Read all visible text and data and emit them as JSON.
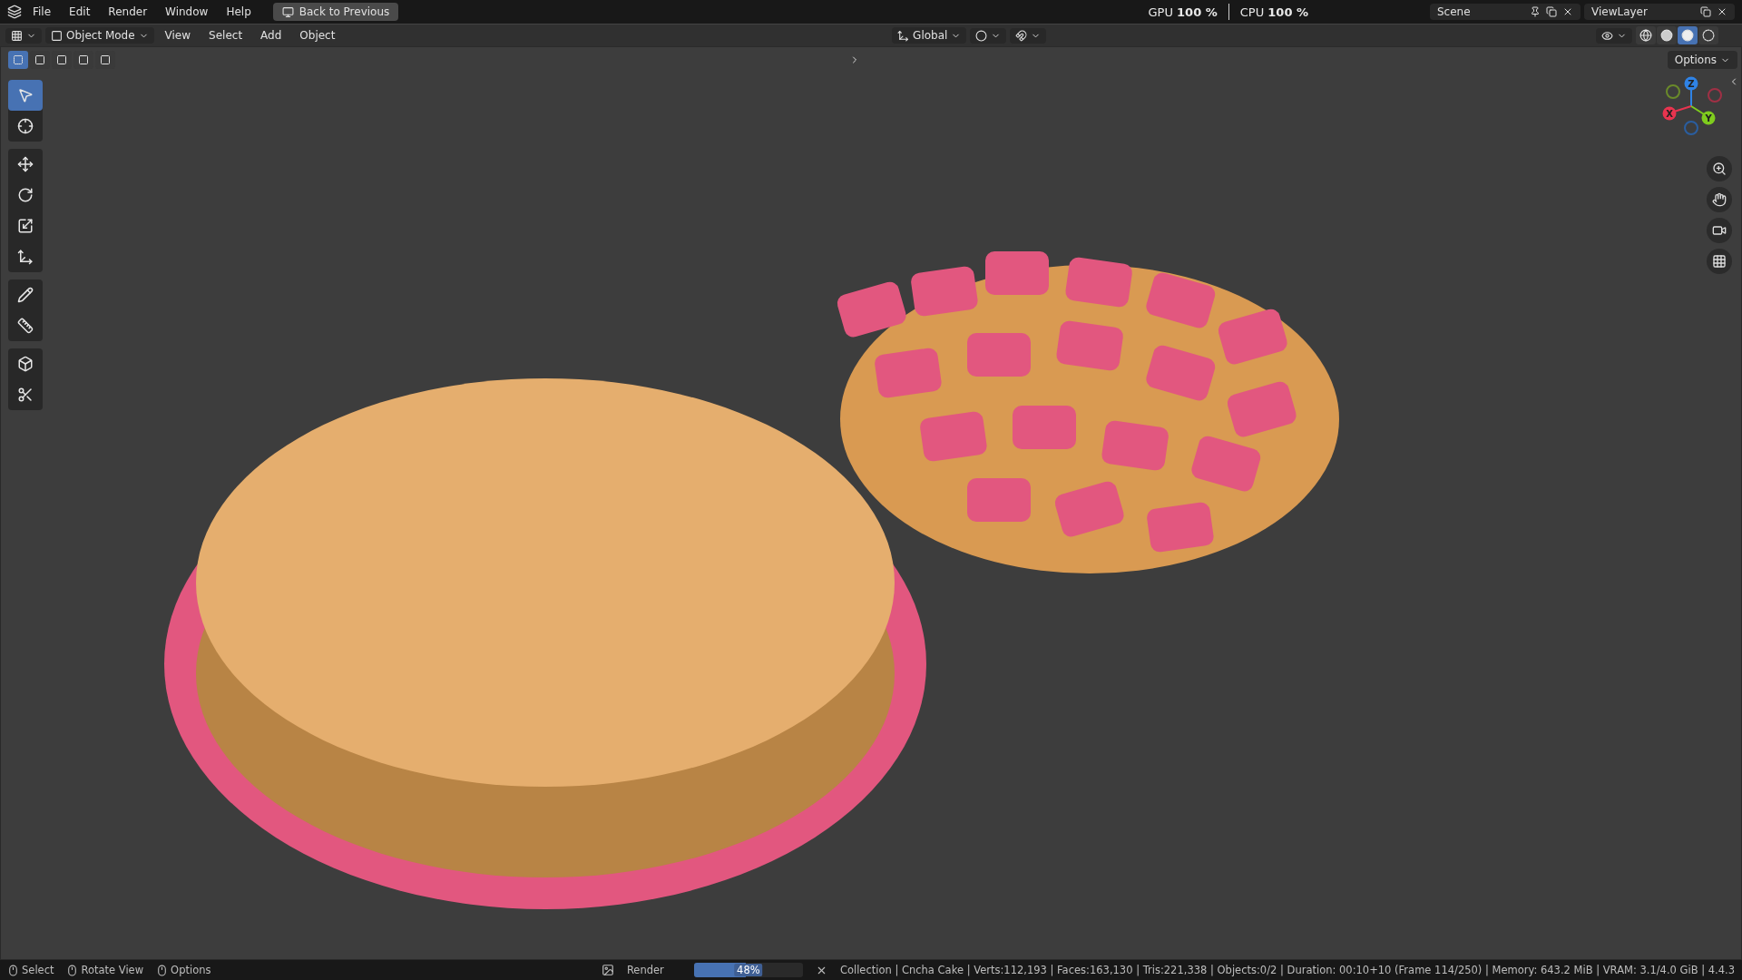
{
  "menu": [
    "File",
    "Edit",
    "Render",
    "Window",
    "Help"
  ],
  "back_button": "Back to Previous",
  "stats": [
    {
      "label": "GPU",
      "value": "100 %"
    },
    {
      "label": "CPU",
      "value": "100 %"
    }
  ],
  "scene": "Scene",
  "view_layer": "ViewLayer",
  "header": {
    "mode": "Object Mode",
    "menus": [
      "View",
      "Select",
      "Add",
      "Object"
    ],
    "orientation": "Global"
  },
  "select_modes": [
    {
      "selected": true
    },
    {
      "selected": false
    },
    {
      "selected": false
    },
    {
      "selected": false
    },
    {
      "selected": false
    }
  ],
  "shading_modes": [
    {
      "kind": "wireframe",
      "selected": false
    },
    {
      "kind": "solid",
      "selected": false
    },
    {
      "kind": "material",
      "selected": true
    },
    {
      "kind": "rendered",
      "selected": false
    }
  ],
  "options": "Options",
  "tool_groups": [
    {
      "tools": [
        {
          "kind": "select",
          "selected": true
        },
        {
          "kind": "cursor",
          "selected": false
        }
      ]
    },
    {
      "tools": [
        {
          "kind": "move",
          "selected": false
        },
        {
          "kind": "rotate",
          "selected": false
        },
        {
          "kind": "scale",
          "selected": false
        },
        {
          "kind": "transform",
          "selected": false
        }
      ]
    },
    {
      "tools": [
        {
          "kind": "annotate",
          "selected": false
        },
        {
          "kind": "measure",
          "selected": false
        }
      ]
    },
    {
      "tools": [
        {
          "kind": "add",
          "selected": false
        },
        {
          "kind": "cut",
          "selected": false
        }
      ]
    }
  ],
  "gizmo": {
    "axes": [
      {
        "label": "Z",
        "color": "#2f83e6"
      },
      {
        "label": "X",
        "color": "#e8344f"
      },
      {
        "label": "Y",
        "color": "#7fcc1e"
      }
    ]
  },
  "status": {
    "hints": [
      "Select",
      "Rotate View",
      "Options"
    ],
    "render": {
      "label": "Render",
      "level": 0.48,
      "reading": "48%"
    },
    "info": "Collection | Cncha Cake | Verts:112,193 | Faces:163,130 | Tris:221,338 | Objects:0/2 | Duration: 00:10+10 (Frame 114/250) | Memory: 643.2 MiB | VRAM: 3.1/4.0 GiB | 4.4.3"
  }
}
